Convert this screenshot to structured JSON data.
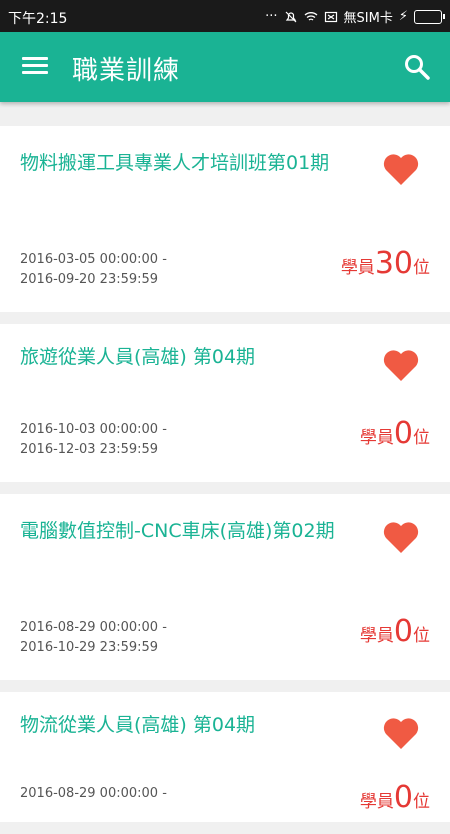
{
  "status_bar": {
    "time": "下午2:15",
    "carrier": "無SIM卡"
  },
  "app_bar": {
    "title": "職業訓練",
    "menu_icon": "menu-icon",
    "search_icon": "search-icon"
  },
  "accent_color": "#1ab394",
  "favorite_color": "#f05a43",
  "count_color": "#e53935",
  "courses": [
    {
      "title": "物料搬運工具專業人才培訓班第01期",
      "start": "2016-03-05 00:00:00 -",
      "end": "2016-09-20 23:59:59",
      "count_prefix": "學員",
      "count": "30",
      "count_suffix": "位"
    },
    {
      "title": "旅遊從業人員(高雄) 第04期",
      "start": "2016-10-03 00:00:00 -",
      "end": "2016-12-03 23:59:59",
      "count_prefix": "學員",
      "count": "0",
      "count_suffix": "位"
    },
    {
      "title": "電腦數值控制-CNC車床(高雄)第02期",
      "start": "2016-08-29 00:00:00 -",
      "end": "2016-10-29 23:59:59",
      "count_prefix": "學員",
      "count": "0",
      "count_suffix": "位"
    },
    {
      "title": "物流從業人員(高雄) 第04期",
      "start": "2016-08-29 00:00:00 -",
      "end": "",
      "count_prefix": "學員",
      "count": "0",
      "count_suffix": "位"
    }
  ]
}
